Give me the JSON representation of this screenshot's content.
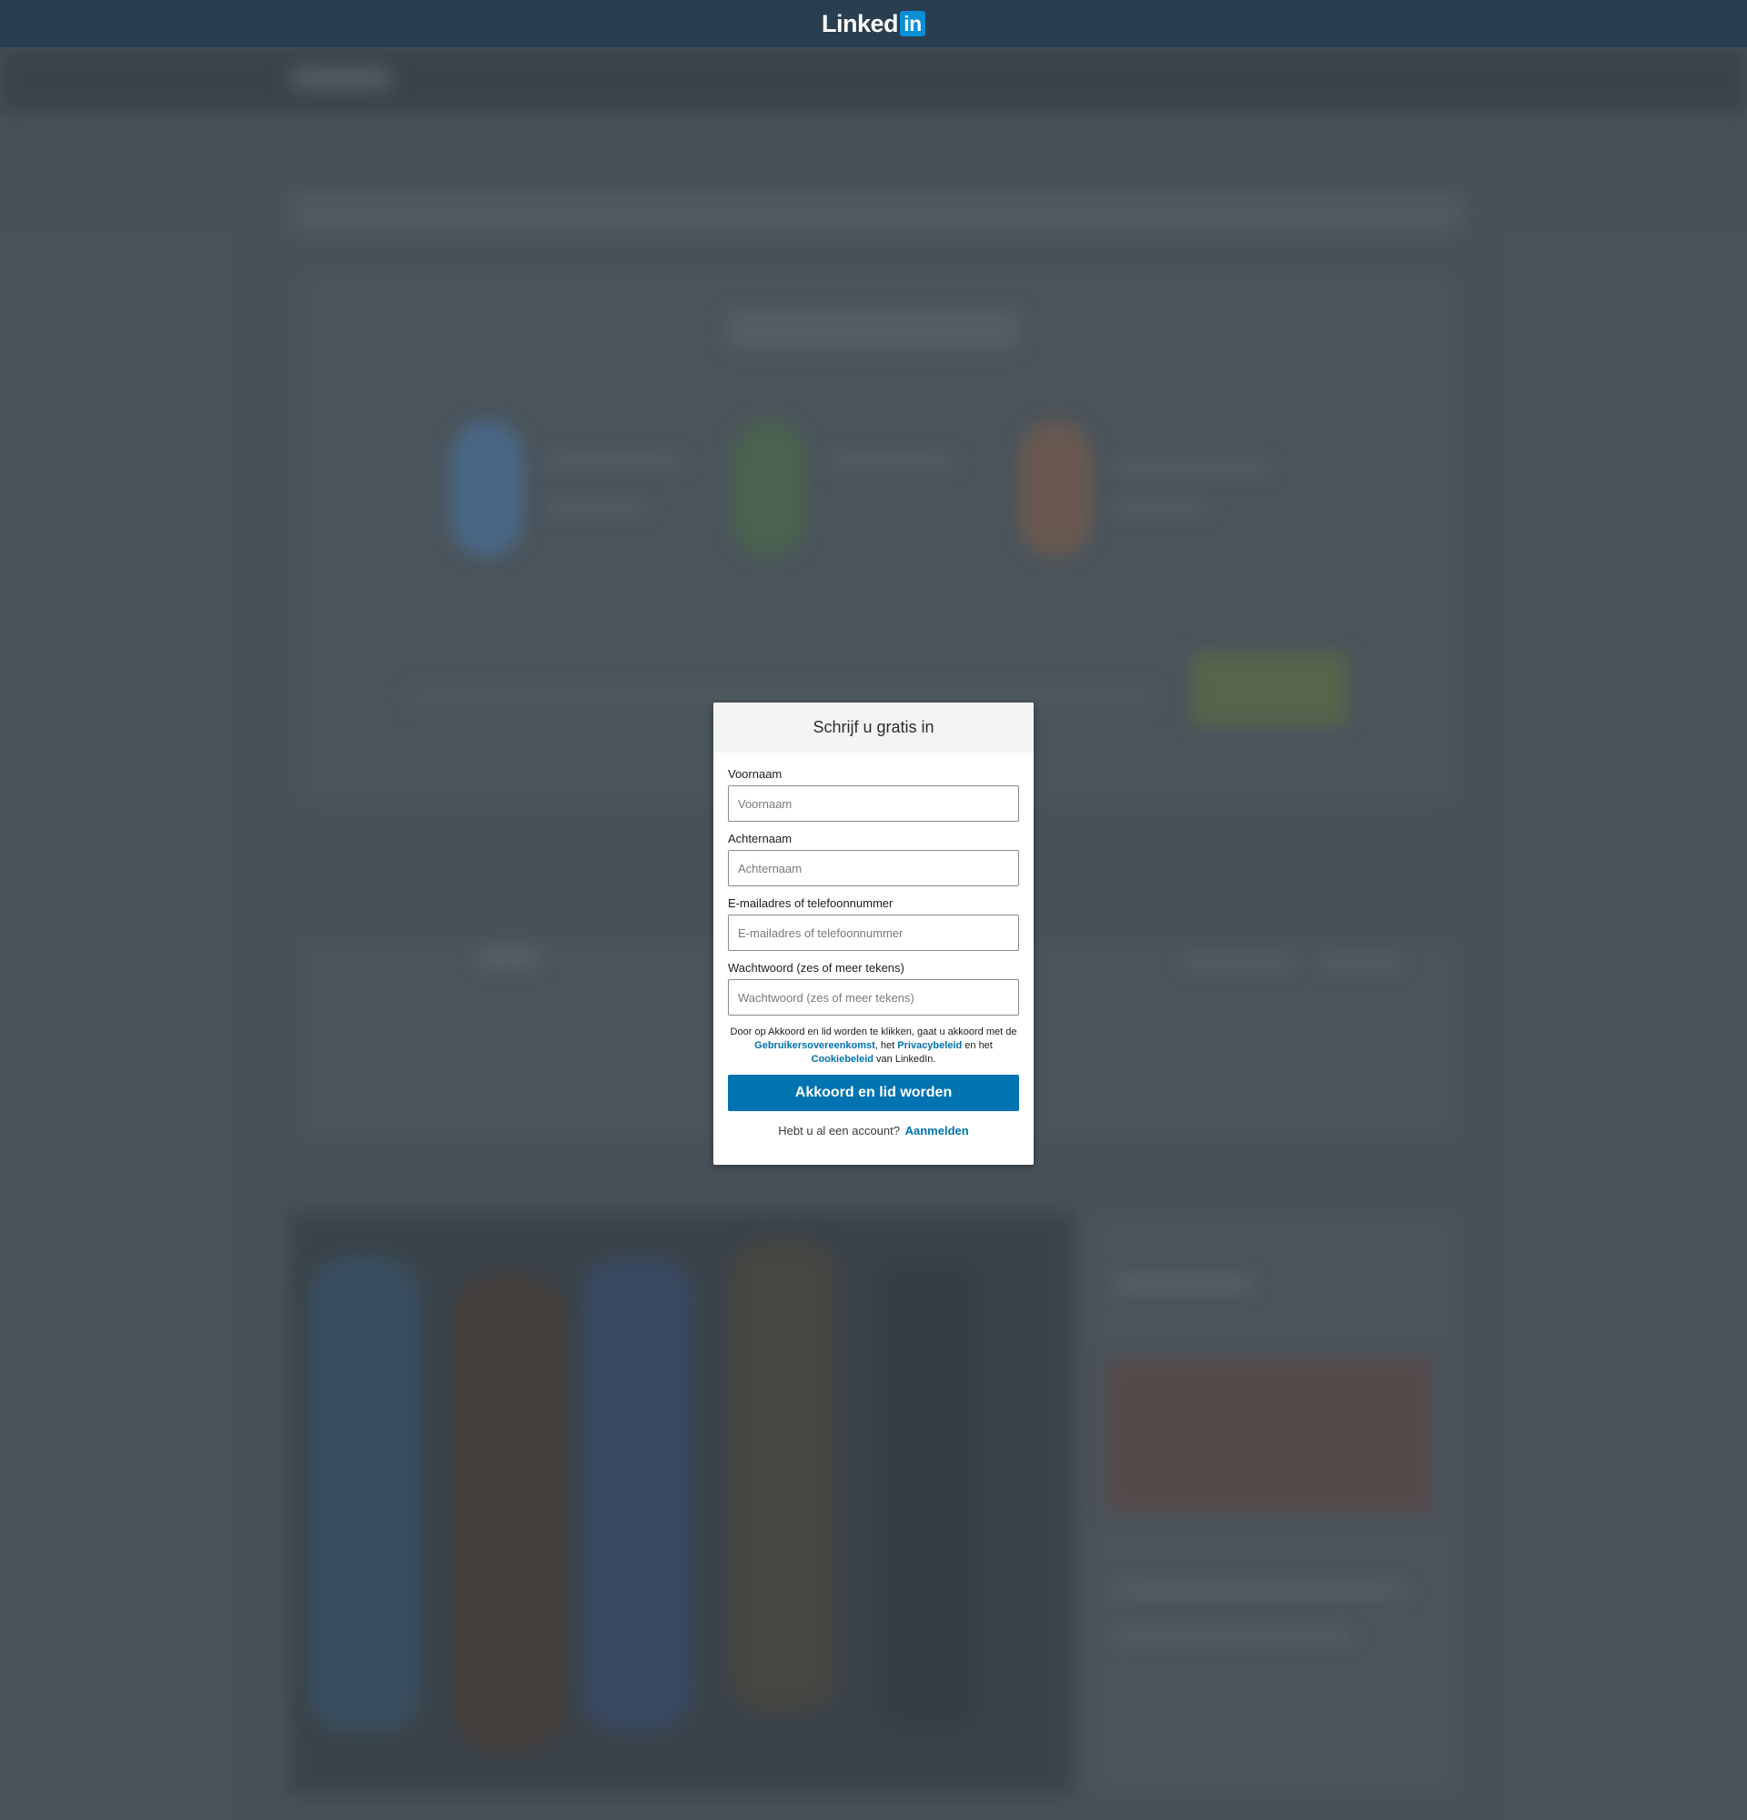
{
  "header": {
    "logo_text": "Linked",
    "logo_box_text": "in"
  },
  "modal": {
    "title": "Schrijf u gratis in",
    "fields": [
      {
        "label": "Voornaam",
        "placeholder": "Voornaam",
        "value": ""
      },
      {
        "label": "Achternaam",
        "placeholder": "Achternaam",
        "value": ""
      },
      {
        "label": "E-mailadres of telefoonnummer",
        "placeholder": "E-mailadres of telefoonnummer",
        "value": ""
      },
      {
        "label": "Wachtwoord (zes of meer tekens)",
        "placeholder": "Wachtwoord (zes of meer tekens)",
        "value": ""
      }
    ],
    "terms": {
      "text_1": "Door op Akkoord en lid worden te klikken, gaat u akkoord met de ",
      "link_agreement": "Gebruikersovereenkomst",
      "text_2": ", het ",
      "link_privacy": "Privacybeleid",
      "text_3": " en het ",
      "link_cookie": "Cookiebeleid",
      "text_4": " van LinkedIn."
    },
    "submit_label": "Akkoord en lid worden",
    "signin_prompt": "Hebt u al een account?",
    "signin_link": "Aanmelden"
  },
  "colors": {
    "header_bg": "#293e4f",
    "brand_blue": "#0073b1",
    "logo_box": "#0a8fd6",
    "backdrop": "#4c565d"
  }
}
